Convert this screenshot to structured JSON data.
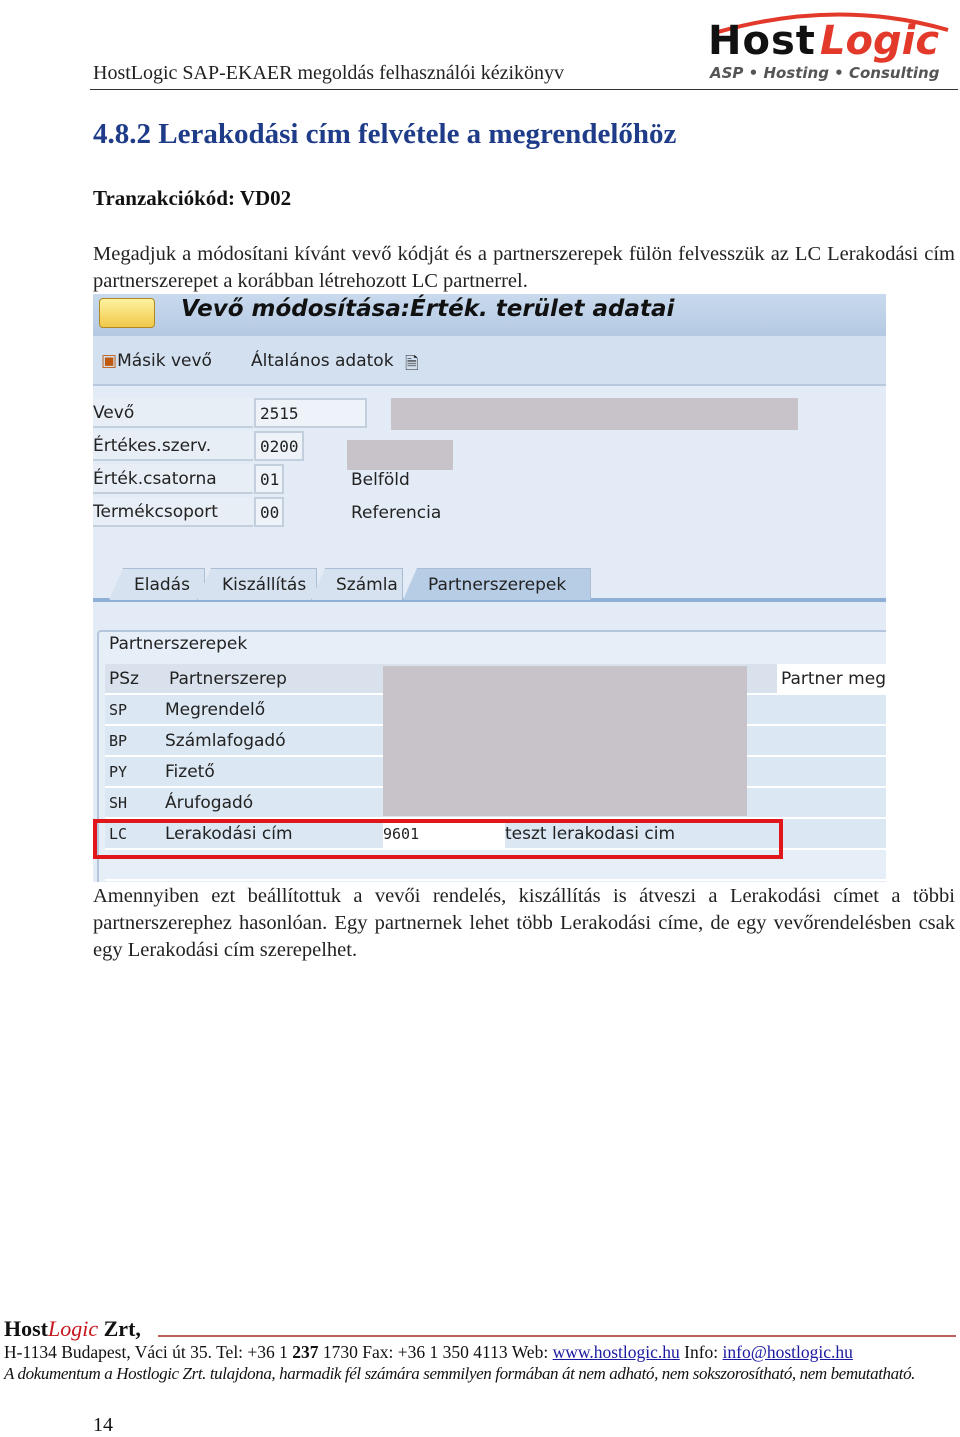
{
  "header": {
    "doc_title": "HostLogic SAP-EKAER megoldás felhasználói kézikönyv",
    "logo": {
      "host": "Host",
      "logic": "Logic",
      "tagline": "ASP • Hosting • Consulting",
      "colors": {
        "red": "#e3392b",
        "black": "#111111"
      }
    }
  },
  "section": {
    "heading": "4.8.2 Lerakodási cím felvétele a megrendelőhöz",
    "tcode": "Tranzakciókód: VD02",
    "intro": "Megadjuk a módosítani kívánt vevő kódját és a partnerszerepek fülön felvesszük az LC Lerakodási cím partnerszerepet a korábban létrehozott LC partnerrel.",
    "outro": "Amennyiben ezt beállítottuk a vevői rendelés, kiszállítás is átveszi a Lerakodási címet a többi partnerszerephez hasonlóan. Egy partnernek lehet több Lerakodási címe, de egy vevőrendelésben csak egy Lerakodási cím szerepelhet."
  },
  "sap": {
    "title": "Vevő módosítása:Érték. terület adatai",
    "toolbar": {
      "other_customer": "Másik vevő",
      "general_data": "Általános adatok"
    },
    "fields": [
      {
        "label": "Vevő",
        "value": "2515",
        "desc": ""
      },
      {
        "label": "Értékes.szerv.",
        "value": "0200",
        "desc": ""
      },
      {
        "label": "Érték.csatorna",
        "value": "01",
        "desc": "Belföld"
      },
      {
        "label": "Termékcsoport",
        "value": "00",
        "desc": "Referencia"
      }
    ],
    "tabs": [
      "Eladás",
      "Kiszállítás",
      "Számla",
      "Partnerszerepek"
    ],
    "active_tab": "Partnerszerepek",
    "group_title": "Partnerszerepek",
    "columns": [
      "PSz",
      "Partnerszerep",
      "",
      "",
      "Partner megr"
    ],
    "rows": [
      {
        "code": "SP",
        "role": "Megrendelő",
        "partner": "",
        "name": ""
      },
      {
        "code": "BP",
        "role": "Számlafogadó",
        "partner": "",
        "name": ""
      },
      {
        "code": "PY",
        "role": "Fizető",
        "partner": "",
        "name": ""
      },
      {
        "code": "SH",
        "role": "Árufogadó",
        "partner": "",
        "name": ""
      },
      {
        "code": "LC",
        "role": "Lerakodási cím",
        "partner": "9601",
        "name": "teszt lerakodasi cim"
      }
    ],
    "highlight_color": "#e0161b"
  },
  "footer": {
    "company_host": "Host",
    "company_logic": "Logic",
    "company_suffix": " Zrt,",
    "addr1": "H-1134 Budapest, Váci út 35. Tel: +36 1 ",
    "addr_bold": "237",
    "addr2": " 1730 Fax: +36 1 350 4113 Web: ",
    "web": "www.hostlogic.hu",
    "info_label": " Info: ",
    "email": "info@hostlogic.hu",
    "notice": "A dokumentum a Hostlogic Zrt. tulajdona, harmadik fél számára semmilyen formában át nem adható, nem sokszorosítható, nem bemutatható.",
    "page_number": "14"
  }
}
